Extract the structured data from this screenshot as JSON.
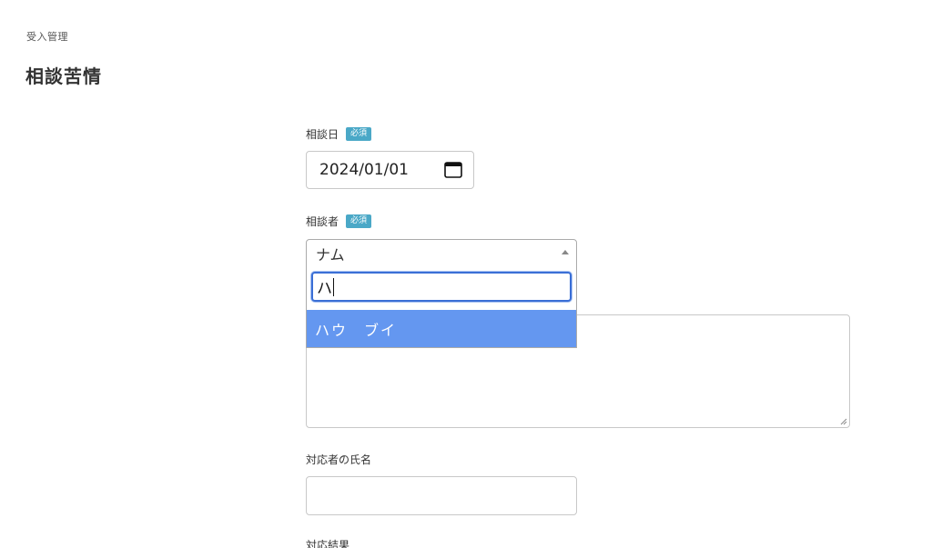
{
  "breadcrumb": "受入管理",
  "page_title": "相談苦情",
  "fields": {
    "consultation_date": {
      "label": "相談日",
      "required_badge": "必須",
      "value": "2024/01/01",
      "icon": "calendar-icon"
    },
    "consultant": {
      "label": "相談者",
      "required_badge": "必須",
      "selected_value": "ナム",
      "search_value": "ハ",
      "options": [
        "ハウ　ブイ"
      ],
      "highlighted_option": "ハウ　ブイ"
    },
    "responder_name": {
      "label": "対応者の氏名",
      "value": ""
    },
    "response_result": {
      "label": "対応結果"
    }
  },
  "colors": {
    "badge": "#4aa8c7",
    "highlight": "#6497f0",
    "focus_border": "#3b6fd6"
  }
}
